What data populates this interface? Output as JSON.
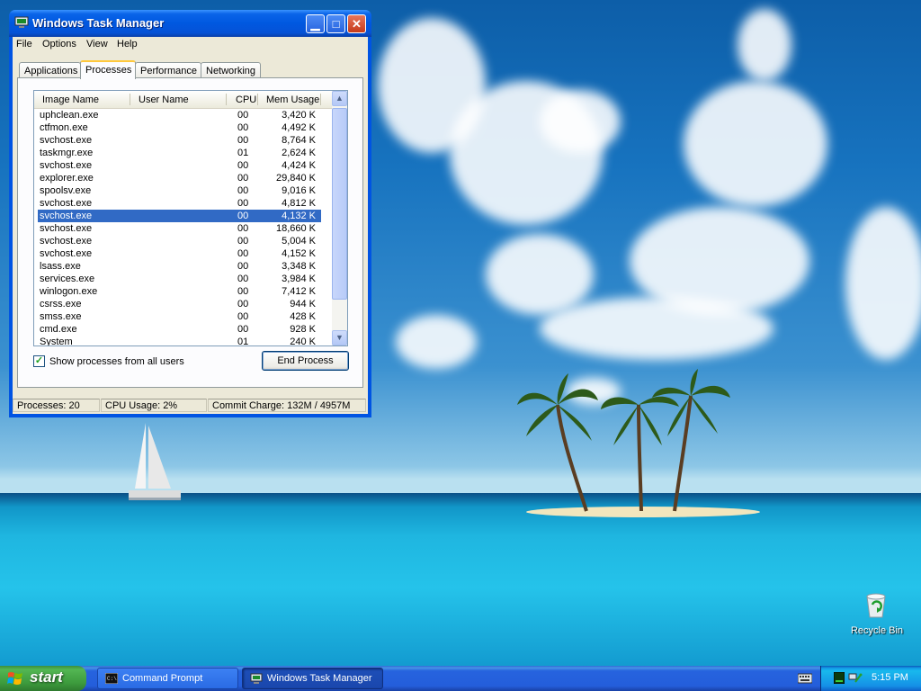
{
  "window": {
    "title": "Windows Task Manager",
    "menu": [
      "File",
      "Options",
      "View",
      "Help"
    ],
    "tabs": [
      "Applications",
      "Processes",
      "Performance",
      "Networking"
    ],
    "active_tab": "Processes",
    "columns": [
      "Image Name",
      "User Name",
      "CPU",
      "Mem Usage"
    ],
    "processes": [
      {
        "name": "uphclean.exe",
        "cpu": "00",
        "mem": "3,420 K"
      },
      {
        "name": "ctfmon.exe",
        "cpu": "00",
        "mem": "4,492 K"
      },
      {
        "name": "svchost.exe",
        "cpu": "00",
        "mem": "8,764 K"
      },
      {
        "name": "taskmgr.exe",
        "cpu": "01",
        "mem": "2,624 K"
      },
      {
        "name": "svchost.exe",
        "cpu": "00",
        "mem": "4,424 K"
      },
      {
        "name": "explorer.exe",
        "cpu": "00",
        "mem": "29,840 K"
      },
      {
        "name": "spoolsv.exe",
        "cpu": "00",
        "mem": "9,016 K"
      },
      {
        "name": "svchost.exe",
        "cpu": "00",
        "mem": "4,812 K"
      },
      {
        "name": "svchost.exe",
        "cpu": "00",
        "mem": "4,132 K",
        "selected": true
      },
      {
        "name": "svchost.exe",
        "cpu": "00",
        "mem": "18,660 K"
      },
      {
        "name": "svchost.exe",
        "cpu": "00",
        "mem": "5,004 K"
      },
      {
        "name": "svchost.exe",
        "cpu": "00",
        "mem": "4,152 K"
      },
      {
        "name": "lsass.exe",
        "cpu": "00",
        "mem": "3,348 K"
      },
      {
        "name": "services.exe",
        "cpu": "00",
        "mem": "3,984 K"
      },
      {
        "name": "winlogon.exe",
        "cpu": "00",
        "mem": "7,412 K"
      },
      {
        "name": "csrss.exe",
        "cpu": "00",
        "mem": "944 K"
      },
      {
        "name": "smss.exe",
        "cpu": "00",
        "mem": "428 K"
      },
      {
        "name": "cmd.exe",
        "cpu": "00",
        "mem": "928 K"
      },
      {
        "name": "System",
        "cpu": "01",
        "mem": "240 K"
      }
    ],
    "show_all_label": "Show processes from all users",
    "show_all_checked": true,
    "end_process_label": "End Process",
    "status": {
      "processes": "Processes: 20",
      "cpu": "CPU Usage: 2%",
      "commit": "Commit Charge: 132M / 4957M"
    }
  },
  "desktop": {
    "recycle_bin_label": "Recycle Bin"
  },
  "taskbar": {
    "start_label": "start",
    "tasks": [
      {
        "label": "Command Prompt",
        "active": false
      },
      {
        "label": "Windows Task Manager",
        "active": true
      }
    ],
    "clock": "5:15 PM"
  },
  "colors": {
    "selection": "#316ac5",
    "titlebar": "#0058e0",
    "start_green": "#3c9a3c"
  }
}
